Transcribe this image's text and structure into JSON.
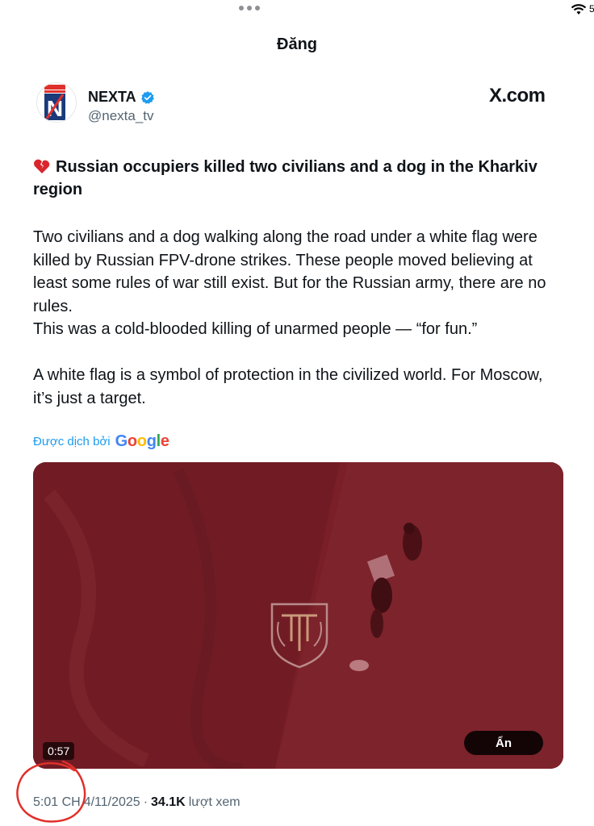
{
  "header": {
    "title": "Đăng"
  },
  "status_bar": {
    "battery_text": "5"
  },
  "author": {
    "name": "NEXTA",
    "handle": "@nexta_tv",
    "avatar_letter": "N",
    "verified_icon": "verified-badge-icon"
  },
  "source": {
    "label": "X.com"
  },
  "tweet": {
    "title": "Russian occupiers killed two civilians and a dog in the Kharkiv region",
    "title_emoji_icon": "broken-heart-icon",
    "paragraph_1": "Two civilians and a dog walking along the road under a white flag were killed by Russian FPV-drone strikes. These people moved believing at least some rules of war still exist. But for the Russian army, there are no rules.",
    "paragraph_2": "This was a cold-blooded killing of unarmed people — “for fun.”",
    "paragraph_3": "A white flag is a symbol of protection in the civilized world. For Moscow, it’s just a target."
  },
  "translation": {
    "label": "Được dịch bởi",
    "provider": "Google"
  },
  "video": {
    "duration": "0:57",
    "hide_label": "Ẩn",
    "overlay_color": "#7a1f27"
  },
  "meta": {
    "time": "5:01 CH",
    "date": "4/11/2025",
    "separator": "·",
    "views": "34.1K",
    "views_label": "lượt xem"
  },
  "colors": {
    "accent_blue": "#1d9bf0",
    "secondary_text": "#536471",
    "annotation_red": "#e0302b"
  }
}
